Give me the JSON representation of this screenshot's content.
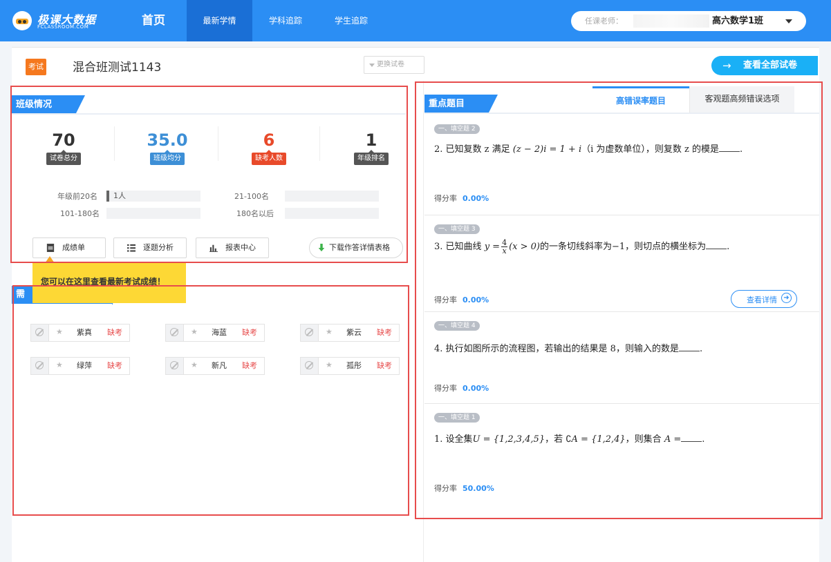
{
  "nav": {
    "logo_name": "极课大数据",
    "logo_sub": "FCLASSROOM.COM",
    "home": "首页",
    "latest": "最新学情",
    "subject": "学科追踪",
    "student": "学生追踪",
    "teacher_label": "任课老师：",
    "class_select": "高六数学1班"
  },
  "exam": {
    "tag": "考试",
    "title": "混合班测试1143",
    "change_exam": "更换试卷",
    "view_all": "查看全部试卷",
    "view_all_arrow": "→"
  },
  "class_section": {
    "header": "班级情况",
    "stats": [
      {
        "value": "70",
        "label": "试卷总分",
        "color": "#333333",
        "label_bg": "#555555"
      },
      {
        "value": "35.0",
        "label": "班级均分",
        "color": "#3d8fd6",
        "label_bg": "#3d8fd6"
      },
      {
        "value": "6",
        "label": "缺考人数",
        "color": "#e84a2a",
        "label_bg": "#e84a2a"
      },
      {
        "value": "1",
        "label": "年级排名",
        "color": "#333333",
        "label_bg": "#555555"
      }
    ],
    "ranks": [
      {
        "label": "年级前20名",
        "value": "1人",
        "share": 0.04
      },
      {
        "label": "21-100名",
        "value": "",
        "share": 0
      },
      {
        "label": "101-180名",
        "value": "",
        "share": 0
      },
      {
        "label": "180名以后",
        "value": "",
        "share": 0
      }
    ],
    "buttons": {
      "score_list": "成绩单",
      "item_analysis": "逐题分析",
      "report_center": "报表中心",
      "download": "下载作答详情表格"
    },
    "tooltip": "您可以在这里查看最新考试成绩！"
  },
  "attention_section": {
    "header": "需",
    "students": [
      {
        "name": "紫真",
        "status": "缺考"
      },
      {
        "name": "海蓝",
        "status": "缺考"
      },
      {
        "name": "紫云",
        "status": "缺考"
      },
      {
        "name": "绿萍",
        "status": "缺考"
      },
      {
        "name": "新凡",
        "status": "缺考"
      },
      {
        "name": "孤彤",
        "status": "缺考"
      }
    ]
  },
  "key_questions": {
    "header": "重点题目",
    "tabs": [
      "高错误率题目",
      "客观题高频错误选项"
    ],
    "rate_label": "得分率",
    "detail_button": "查看详情",
    "questions": [
      {
        "badge": "一、填空题 2",
        "pre": "2. 已知复数 z 满足",
        "math": "(z − 2)i = 1 + i",
        "post": "（i 为虚数单位），则复数 z 的模是",
        "end": ".",
        "rate": "0.00%"
      },
      {
        "badge": "一、填空题 3",
        "pre": "3. 已知曲线",
        "frac_lhs": "y =",
        "frac_num": "4",
        "frac_den": "x",
        "math": "(x > 0)",
        "post": "的一条切线斜率为−1，则切点的横坐标为",
        "end": ".",
        "rate": "0.00%"
      },
      {
        "badge": "一、填空题 4",
        "pre": "4. 执行如图所示的流程图，若输出的结果是 8，则输入的数是",
        "math": "",
        "post": "",
        "end": ".",
        "rate": "0.00%"
      },
      {
        "badge": "一、填空题 1",
        "pre": "1. 设全集",
        "math": "U = {1,2,3,4,5}",
        "post": "，若 ∁",
        "math2": "A = {1,2,4}",
        "post2": "，则集合",
        "math3": "A =",
        "end": ".",
        "rate": "50.00%"
      }
    ]
  },
  "colors": {
    "brand": "#2b8ef4",
    "accent_orange": "#f5781e",
    "alert_red": "#e84a2a",
    "annotation": "#e74c4c"
  }
}
